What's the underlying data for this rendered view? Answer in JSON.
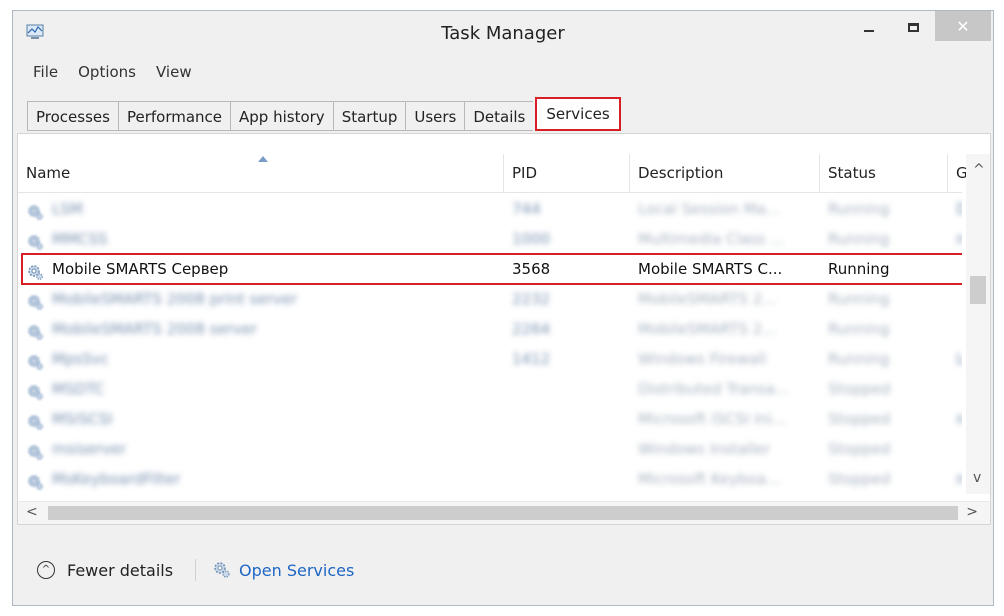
{
  "window": {
    "title": "Task Manager",
    "close_glyph": "✕"
  },
  "menu": [
    "File",
    "Options",
    "View"
  ],
  "tabs": [
    "Processes",
    "Performance",
    "App history",
    "Startup",
    "Users",
    "Details",
    "Services"
  ],
  "active_tab": "Services",
  "table": {
    "columns": [
      "Name",
      "PID",
      "Description",
      "Status",
      "Gr"
    ],
    "rows": [
      {
        "name": "LSM",
        "pid": "744",
        "description": "Local Session Ma...",
        "status": "Running",
        "group": "D:",
        "blurred": true
      },
      {
        "name": "MMCSS",
        "pid": "1000",
        "description": "Multimedia Class ...",
        "status": "Running",
        "group": "ne",
        "blurred": true
      },
      {
        "name": "Mobile SMARTS Сервер",
        "pid": "3568",
        "description": "Mobile SMARTS C...",
        "status": "Running",
        "group": "",
        "blurred": false,
        "highlighted": true
      },
      {
        "name": "MobileSMARTS 2008 print server",
        "pid": "2232",
        "description": "MobileSMARTS 2...",
        "status": "Running",
        "group": "",
        "blurred": true
      },
      {
        "name": "MobileSMARTS 2008 server",
        "pid": "2264",
        "description": "MobileSMARTS 2...",
        "status": "Running",
        "group": "",
        "blurred": true
      },
      {
        "name": "MpsSvc",
        "pid": "1412",
        "description": "Windows Firewall",
        "status": "Running",
        "group": "Lo",
        "blurred": true
      },
      {
        "name": "MSDTC",
        "pid": "",
        "description": "Distributed Transa...",
        "status": "Stopped",
        "group": "",
        "blurred": true
      },
      {
        "name": "MSiSCSI",
        "pid": "",
        "description": "Microsoft iSCSI Ini...",
        "status": "Stopped",
        "group": "ne",
        "blurred": true
      },
      {
        "name": "msiserver",
        "pid": "",
        "description": "Windows Installer",
        "status": "Stopped",
        "group": "",
        "blurred": true
      },
      {
        "name": "MsKeyboardFilter",
        "pid": "",
        "description": "Microsoft Keyboa...",
        "status": "Stopped",
        "group": "ne",
        "blurred": true
      }
    ]
  },
  "scroll": {
    "up": "^",
    "down": "v",
    "left": "<",
    "right": ">"
  },
  "footer": {
    "fewer_details": "Fewer details",
    "fewer_glyph": "^",
    "open_services": "Open Services"
  },
  "colors": {
    "highlight": "#d81f26",
    "link": "#1e66c4"
  }
}
